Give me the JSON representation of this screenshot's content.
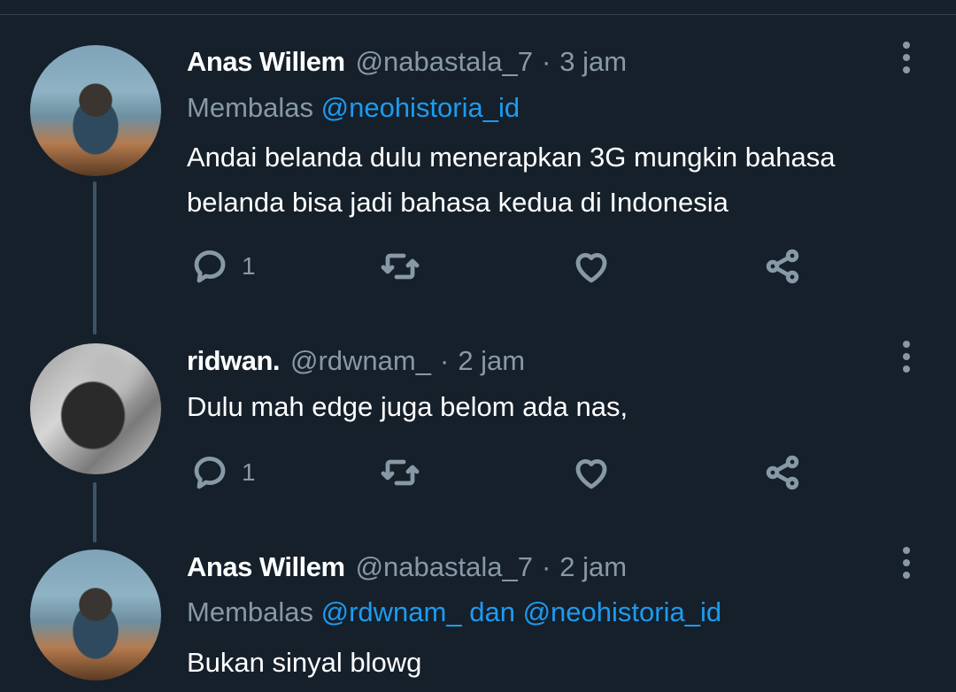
{
  "tweets": [
    {
      "name": "Anas Willem",
      "handle": "@nabastala_7",
      "sep": "·",
      "time": "3 jam",
      "reply_prefix": "Membalas",
      "reply_mentions": "@neohistoria_id",
      "text_line1": "Andai belanda dulu menerapkan 3G mungkin bahasa",
      "text_line2": "belanda bisa jadi bahasa kedua di Indonesia",
      "reply_count": "1",
      "avatar_icon": "profile-photo"
    },
    {
      "name": "ridwan.",
      "handle": "@rdwnam_",
      "sep": "·",
      "time": "2 jam",
      "text_line1": "Dulu mah edge juga belom ada nas,",
      "reply_count": "1",
      "avatar_icon": "profile-photo"
    },
    {
      "name": "Anas Willem",
      "handle": "@nabastala_7",
      "sep": "·",
      "time": "2 jam",
      "reply_prefix": "Membalas",
      "reply_mention_1": "@rdwnam_",
      "reply_conj": "dan",
      "reply_mention_2": "@neohistoria_id",
      "text_line1": "Bukan sinyal blowg",
      "avatar_icon": "profile-photo"
    }
  ],
  "icons": {
    "reply": "reply-icon",
    "retweet": "retweet-icon",
    "like": "like-icon",
    "share": "share-icon",
    "more": "more-icon"
  },
  "colors": {
    "background": "#15202b",
    "accent": "#1d9bf0",
    "secondary_text": "#8899a6",
    "thread_line": "#3d5466"
  }
}
